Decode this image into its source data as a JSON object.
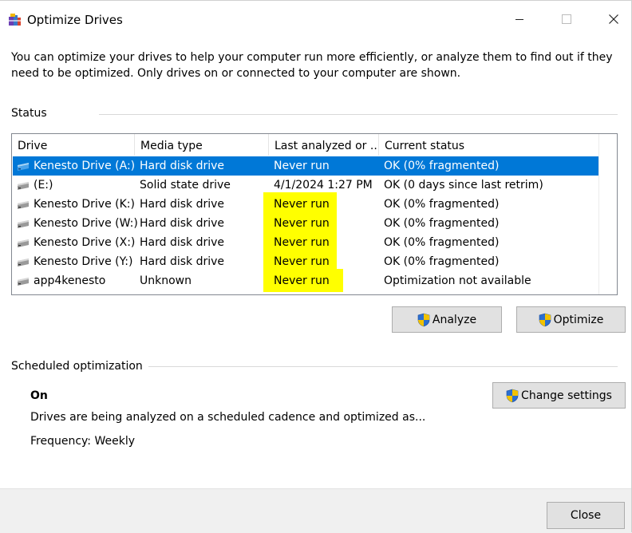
{
  "window": {
    "title": "Optimize Drives"
  },
  "intro_text": "You can optimize your drives to help your computer run more efficiently, or analyze them to find out if they need to be optimized. Only drives on or connected to your computer are shown.",
  "status": {
    "label": "Status",
    "columns": [
      "Drive",
      "Media type",
      "Last analyzed or ...",
      "Current status"
    ],
    "rows": [
      {
        "drive": "Kenesto Drive (A:)",
        "media": "Hard disk drive",
        "last": "Never run",
        "status": "OK (0% fragmented)",
        "selected": true,
        "highlight": false,
        "icon": "network-drive-icon"
      },
      {
        "drive": "(E:)",
        "media": "Solid state drive",
        "last": "4/1/2024 1:27 PM",
        "status": "OK (0 days since last retrim)",
        "selected": false,
        "highlight": false,
        "icon": "drive-icon"
      },
      {
        "drive": "Kenesto Drive (K:)",
        "media": "Hard disk drive",
        "last": "Never run",
        "status": "OK (0% fragmented)",
        "selected": false,
        "highlight": true,
        "icon": "drive-icon"
      },
      {
        "drive": "Kenesto Drive (W:)",
        "media": "Hard disk drive",
        "last": "Never run",
        "status": "OK (0% fragmented)",
        "selected": false,
        "highlight": true,
        "icon": "drive-icon"
      },
      {
        "drive": "Kenesto Drive (X:)",
        "media": "Hard disk drive",
        "last": "Never run",
        "status": "OK (0% fragmented)",
        "selected": false,
        "highlight": true,
        "icon": "drive-icon"
      },
      {
        "drive": "Kenesto Drive (Y:)",
        "media": "Hard disk drive",
        "last": "Never run",
        "status": "OK (0% fragmented)",
        "selected": false,
        "highlight": true,
        "icon": "drive-icon"
      },
      {
        "drive": "app4kenesto",
        "media": "Unknown",
        "last": "Never run",
        "status": "Optimization not available",
        "selected": false,
        "highlight": true,
        "icon": "drive-icon"
      }
    ],
    "highlight_color": "#ffff00",
    "selection_color": "#0078d7"
  },
  "buttons": {
    "analyze": "Analyze",
    "optimize": "Optimize",
    "change_settings": "Change settings",
    "close": "Close"
  },
  "scheduled": {
    "label": "Scheduled optimization",
    "state": "On",
    "description": "Drives are being analyzed on a scheduled cadence and optimized as...",
    "frequency": "Frequency: Weekly"
  }
}
